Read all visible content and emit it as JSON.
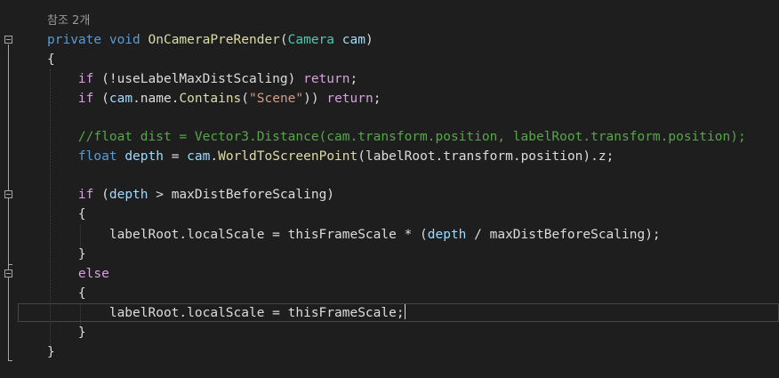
{
  "editor": {
    "reference_hint": "참조 2개",
    "signature": {
      "modifier": "private",
      "return_type": "void",
      "method_name": "OnCameraPreRender",
      "open_paren": "(",
      "param_type": "Camera",
      "param_name": "cam",
      "close_paren": ")"
    },
    "open_brace": "{",
    "close_brace": "}",
    "line3": {
      "kw": "if",
      "rest": " (!useLabelMaxDistScaling) ",
      "ret": "return",
      "end": ";"
    },
    "line4": {
      "kw": "if",
      "p1": " (",
      "cam": "cam",
      "p2": ".name.",
      "method": "Contains",
      "p3": "(",
      "str": "\"Scene\"",
      "p4": ")) ",
      "ret": "return",
      "end": ";"
    },
    "comment": "//float dist = Vector3.Distance(cam.transform.position, labelRoot.transform.position);",
    "line7": {
      "type": "float",
      "var": "depth",
      "eq": " = ",
      "cam": "cam",
      "dot": ".",
      "method": "WorldToScreenPoint",
      "rest": "(labelRoot.transform.position).z;"
    },
    "line9": {
      "kw": "if",
      "p1": " (",
      "var": "depth",
      "rest": " > maxDistBeforeScaling)"
    },
    "line10_brace": "{",
    "line11": {
      "a": "labelRoot.localScale = thisFrameScale * (",
      "var": "depth",
      "b": " / maxDistBeforeScaling);"
    },
    "line12_brace": "}",
    "else": "else",
    "line14_brace": "{",
    "line15": "labelRoot.localScale = thisFrameScale;",
    "line16_brace": "}"
  },
  "colors": {
    "background": "#1e1e1e",
    "keyword": "#569cd6",
    "control": "#d8a0df",
    "method": "#dcdcaa",
    "type": "#4ec9b0",
    "parameter": "#9cdcfe",
    "string": "#d69d85",
    "comment": "#57a64a",
    "text": "#dcdcdc"
  },
  "icons": [
    "collapse-icon"
  ]
}
